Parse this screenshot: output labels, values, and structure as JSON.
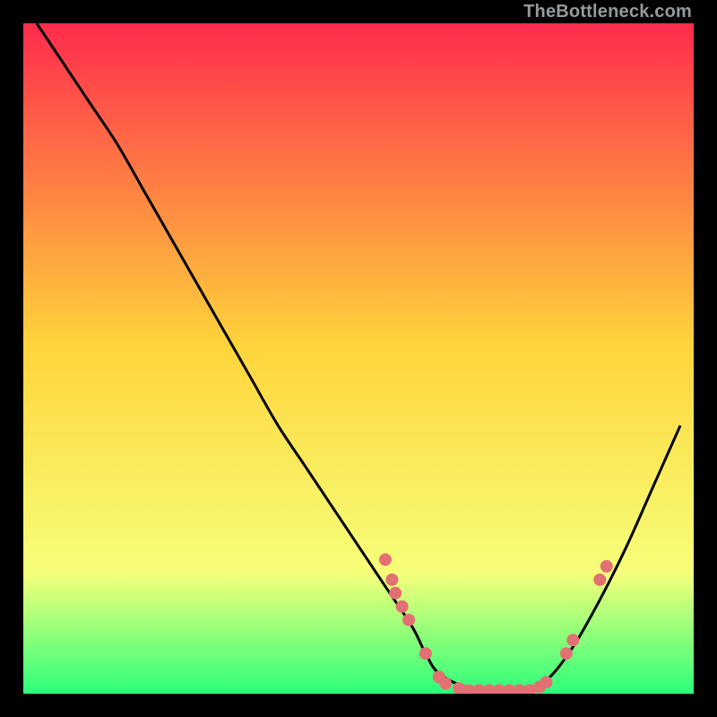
{
  "watermark": "TheBottleneck.com",
  "chart_data": {
    "type": "line",
    "title": "",
    "xlabel": "",
    "ylabel": "",
    "xlim": [
      0,
      100
    ],
    "ylim": [
      0,
      100
    ],
    "grid": false,
    "legend": false,
    "background_gradient": {
      "top": "#ff2b4c",
      "mid_upper": "#ffd43b",
      "mid_lower": "#f6ff7a",
      "bottom": "#2cff7a"
    },
    "series": [
      {
        "name": "bottleneck-curve",
        "color": "#000000",
        "x": [
          2,
          6,
          10,
          14,
          18,
          22,
          26,
          30,
          34,
          38,
          42,
          46,
          50,
          54,
          58,
          60,
          62,
          66,
          70,
          74,
          78,
          82,
          86,
          90,
          94,
          98
        ],
        "y": [
          100,
          94,
          88,
          82,
          75,
          68,
          61,
          54,
          47,
          40,
          34,
          28,
          22,
          16,
          10,
          6,
          3,
          1,
          0.5,
          0.5,
          2,
          7,
          14,
          22,
          31,
          40
        ]
      }
    ],
    "markers": {
      "name": "highlight-points",
      "color": "#e37073",
      "radius": 7,
      "points": [
        {
          "x": 54,
          "y": 20
        },
        {
          "x": 55,
          "y": 17
        },
        {
          "x": 55.5,
          "y": 15
        },
        {
          "x": 56.5,
          "y": 13
        },
        {
          "x": 57.5,
          "y": 11
        },
        {
          "x": 60,
          "y": 6
        },
        {
          "x": 62,
          "y": 2.5
        },
        {
          "x": 63,
          "y": 1.5
        },
        {
          "x": 65,
          "y": 0.8
        },
        {
          "x": 66.5,
          "y": 0.5
        },
        {
          "x": 68,
          "y": 0.5
        },
        {
          "x": 69.5,
          "y": 0.5
        },
        {
          "x": 71,
          "y": 0.5
        },
        {
          "x": 72.5,
          "y": 0.5
        },
        {
          "x": 74,
          "y": 0.5
        },
        {
          "x": 75.5,
          "y": 0.5
        },
        {
          "x": 77,
          "y": 1
        },
        {
          "x": 78,
          "y": 1.7
        },
        {
          "x": 81,
          "y": 6
        },
        {
          "x": 82,
          "y": 8
        },
        {
          "x": 86,
          "y": 17
        },
        {
          "x": 87,
          "y": 19
        }
      ]
    }
  }
}
